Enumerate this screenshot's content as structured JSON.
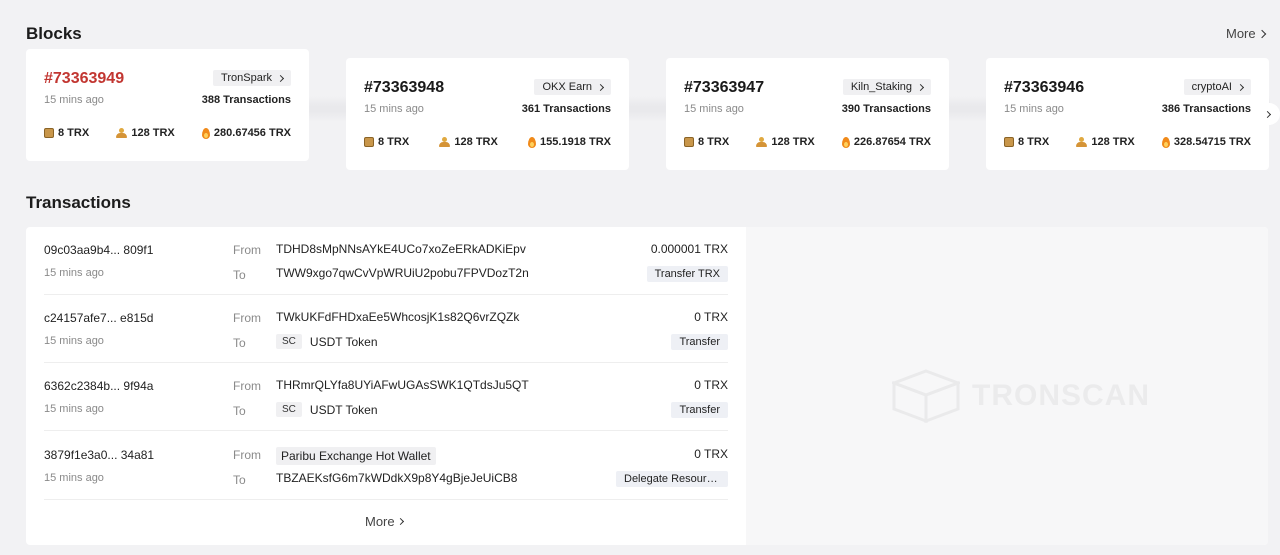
{
  "blocks": {
    "title": "Blocks",
    "more": "More",
    "items": [
      {
        "number": "#73363949",
        "producer": "TronSpark",
        "time": "15 mins ago",
        "tx_count": "388 Transactions",
        "reward": "8 TRX",
        "vote": "128 TRX",
        "burn": "280.67456 TRX"
      },
      {
        "number": "#73363948",
        "producer": "OKX Earn",
        "time": "15 mins ago",
        "tx_count": "361 Transactions",
        "reward": "8 TRX",
        "vote": "128 TRX",
        "burn": "155.1918 TRX"
      },
      {
        "number": "#73363947",
        "producer": "Kiln_Staking",
        "time": "15 mins ago",
        "tx_count": "390 Transactions",
        "reward": "8 TRX",
        "vote": "128 TRX",
        "burn": "226.87654 TRX"
      },
      {
        "number": "#73363946",
        "producer": "cryptoAI",
        "time": "15 mins ago",
        "tx_count": "386 Transactions",
        "reward": "8 TRX",
        "vote": "128 TRX",
        "burn": "328.54715 TRX"
      }
    ]
  },
  "transactions": {
    "title": "Transactions",
    "more": "More",
    "from_label": "From",
    "to_label": "To",
    "sc_label": "SC",
    "items": [
      {
        "hash": "09c03aa9b4... 809f1",
        "time": "15 mins ago",
        "from": "TDHD8sMpNNsAYkE4UCo7xoZeERkADKiEpv",
        "to": "TWW9xgo7qwCvVpWRUiU2pobu7FPVDozT2n",
        "amount": "0.000001 TRX",
        "type": "Transfer TRX"
      },
      {
        "hash": "c24157afe7... e815d",
        "time": "15 mins ago",
        "from": "TWkUKFdFHDxaEe5WhcosjK1s82Q6vrZQZk",
        "to": "USDT Token",
        "amount": "0 TRX",
        "type": "Transfer"
      },
      {
        "hash": "6362c2384b... 9f94a",
        "time": "15 mins ago",
        "from": "THRmrQLYfa8UYiAFwUGAsSWK1QTdsJu5QT",
        "to": "USDT Token",
        "amount": "0 TRX",
        "type": "Transfer"
      },
      {
        "hash": "3879f1e3a0... 34a81",
        "time": "15 mins ago",
        "from": "Paribu Exchange Hot Wallet",
        "to": "TBZAEKsfG6m7kWDdkX9p8Y4gBjeJeUiCB8",
        "amount": "0 TRX",
        "type": "Delegate Resources"
      }
    ]
  },
  "watermark": {
    "text": "TRONSCAN"
  }
}
